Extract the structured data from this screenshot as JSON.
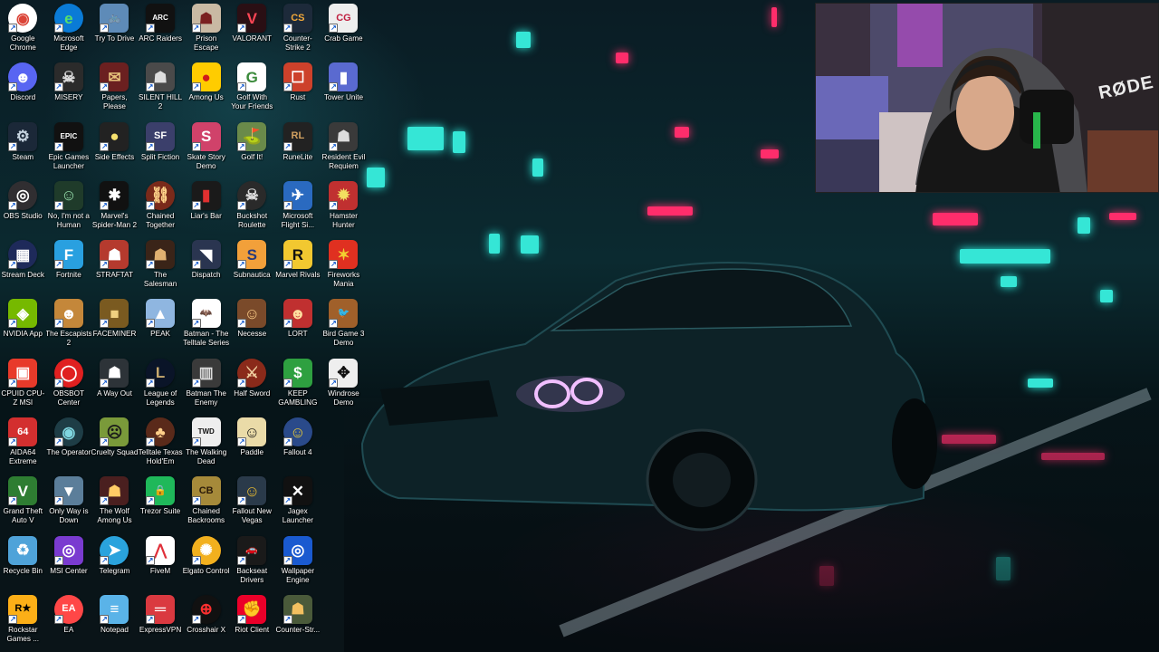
{
  "desktop": {
    "icons": [
      {
        "label": "Google Chrome",
        "icon": "chrome-icon",
        "bg": "#ffffff",
        "fg": "#db4437",
        "glyph": "◉",
        "round": true
      },
      {
        "label": "Discord",
        "icon": "discord-icon",
        "bg": "#5865f2",
        "fg": "#ffffff",
        "glyph": "☻",
        "round": true
      },
      {
        "label": "Steam",
        "icon": "steam-icon",
        "bg": "#1b2838",
        "fg": "#c7d5e0",
        "glyph": "⚙",
        "round": false
      },
      {
        "label": "OBS Studio",
        "icon": "obs-icon",
        "bg": "#302e31",
        "fg": "#ffffff",
        "glyph": "◎",
        "round": true
      },
      {
        "label": "Stream Deck",
        "icon": "stream-deck-icon",
        "bg": "#1e2a5a",
        "fg": "#ffffff",
        "glyph": "▦",
        "round": true
      },
      {
        "label": "NVIDIA App",
        "icon": "nvidia-icon",
        "bg": "#76b900",
        "fg": "#ffffff",
        "glyph": "◈",
        "round": false
      },
      {
        "label": "CPUID CPU-Z MSI",
        "icon": "cpuz-icon",
        "bg": "#e83a2a",
        "fg": "#ffffff",
        "glyph": "▣",
        "round": false
      },
      {
        "label": "AIDA64 Extreme",
        "icon": "aida64-icon",
        "bg": "#d32f2f",
        "fg": "#ffffff",
        "glyph": "64",
        "round": false
      },
      {
        "label": "Grand Theft Auto V",
        "icon": "gta5-icon",
        "bg": "#2e7d32",
        "fg": "#ffffff",
        "glyph": "V",
        "round": false
      },
      {
        "label": "Recycle Bin",
        "icon": "recycle-bin-icon",
        "bg": "#4fa3d9",
        "fg": "#ffffff",
        "glyph": "♻",
        "round": false
      },
      {
        "label": "Rockstar Games ...",
        "icon": "rockstar-icon",
        "bg": "#fcaf17",
        "fg": "#000000",
        "glyph": "R★",
        "round": false
      },
      {
        "label": "Microsoft Edge",
        "icon": "edge-icon",
        "bg": "#0a7bd6",
        "fg": "#58e06a",
        "glyph": "e",
        "round": true
      },
      {
        "label": "MISERY",
        "icon": "misery-icon",
        "bg": "#2b2b2b",
        "fg": "#dddddd",
        "glyph": "☠",
        "round": false
      },
      {
        "label": "Epic Games Launcher",
        "icon": "epic-games-icon",
        "bg": "#111111",
        "fg": "#ffffff",
        "glyph": "EPIC",
        "round": false
      },
      {
        "label": "No, I'm not a Human",
        "icon": "not-human-icon",
        "bg": "#1f3b2a",
        "fg": "#9be3b0",
        "glyph": "☺",
        "round": false
      },
      {
        "label": "Fortnite",
        "icon": "fortnite-icon",
        "bg": "#29a0e0",
        "fg": "#ffffff",
        "glyph": "F",
        "round": false
      },
      {
        "label": "The Escapists 2",
        "icon": "escapists-icon",
        "bg": "#c4873a",
        "fg": "#ffffff",
        "glyph": "☻",
        "round": false
      },
      {
        "label": "OBSBOT Center",
        "icon": "obsbot-icon",
        "bg": "#e02020",
        "fg": "#ffffff",
        "glyph": "◯",
        "round": true
      },
      {
        "label": "The Operator",
        "icon": "operator-icon",
        "bg": "#1e3d46",
        "fg": "#7fd6e0",
        "glyph": "◉",
        "round": true
      },
      {
        "label": "Only Way is Down",
        "icon": "only-way-down-icon",
        "bg": "#5b7e9a",
        "fg": "#ffffff",
        "glyph": "▼",
        "round": false
      },
      {
        "label": "MSI Center",
        "icon": "msi-center-icon",
        "bg": "#7a3bd0",
        "fg": "#ffffff",
        "glyph": "◎",
        "round": false
      },
      {
        "label": "EA",
        "icon": "ea-icon",
        "bg": "#ff4747",
        "fg": "#ffffff",
        "glyph": "EA",
        "round": true
      },
      {
        "label": "Try To Drive",
        "icon": "try-to-drive-icon",
        "bg": "#5e8bb8",
        "fg": "#ffffff",
        "glyph": "🚲",
        "round": false
      },
      {
        "label": "Papers, Please",
        "icon": "papers-please-icon",
        "bg": "#6b2020",
        "fg": "#e6c17a",
        "glyph": "✉",
        "round": false
      },
      {
        "label": "Side Effects",
        "icon": "side-effects-icon",
        "bg": "#222222",
        "fg": "#f5e06e",
        "glyph": "●",
        "round": false
      },
      {
        "label": "Marvel's Spider-Man 2",
        "icon": "spiderman-icon",
        "bg": "#111111",
        "fg": "#ffffff",
        "glyph": "✱",
        "round": false
      },
      {
        "label": "STRAFTAT",
        "icon": "straftat-icon",
        "bg": "#b53a2e",
        "fg": "#ffffff",
        "glyph": "☗",
        "round": false
      },
      {
        "label": "FACEMINER",
        "icon": "faceminer-icon",
        "bg": "#7a5a20",
        "fg": "#f0d080",
        "glyph": "■",
        "round": false
      },
      {
        "label": "A Way Out",
        "icon": "a-way-out-icon",
        "bg": "#2d3338",
        "fg": "#ffffff",
        "glyph": "☗",
        "round": false
      },
      {
        "label": "Cruelty Squad",
        "icon": "cruelty-squad-icon",
        "bg": "#7a9a3a",
        "fg": "#1a1a1a",
        "glyph": "☹",
        "round": false
      },
      {
        "label": "The Wolf Among Us",
        "icon": "wolf-among-us-icon",
        "bg": "#4a1f1f",
        "fg": "#ffcc66",
        "glyph": "☗",
        "round": false
      },
      {
        "label": "Telegram",
        "icon": "telegram-icon",
        "bg": "#2aa3dd",
        "fg": "#ffffff",
        "glyph": "➤",
        "round": true
      },
      {
        "label": "Notepad",
        "icon": "notepad-icon",
        "bg": "#5ab3e8",
        "fg": "#ffffff",
        "glyph": "≡",
        "round": false
      },
      {
        "label": "ARC Raiders",
        "icon": "arc-raiders-icon",
        "bg": "#111111",
        "fg": "#ffffff",
        "glyph": "ARC",
        "round": false
      },
      {
        "label": "SILENT HILL 2",
        "icon": "silent-hill-icon",
        "bg": "#4a4a4a",
        "fg": "#dddddd",
        "glyph": "☗",
        "round": false
      },
      {
        "label": "Split Fiction",
        "icon": "split-fiction-icon",
        "bg": "#3b3f6b",
        "fg": "#ffffff",
        "glyph": "SF",
        "round": false
      },
      {
        "label": "Chained Together",
        "icon": "chained-together-icon",
        "bg": "#7a2a1a",
        "fg": "#ffd38a",
        "glyph": "⛓",
        "round": true
      },
      {
        "label": "The Salesman",
        "icon": "salesman-icon",
        "bg": "#3a2418",
        "fg": "#e0b070",
        "glyph": "☗",
        "round": false
      },
      {
        "label": "PEAK",
        "icon": "peak-icon",
        "bg": "#8fb6e0",
        "fg": "#ffffff",
        "glyph": "▲",
        "round": false
      },
      {
        "label": "League of Legends",
        "icon": "league-icon",
        "bg": "#0a1428",
        "fg": "#c8aa6e",
        "glyph": "L",
        "round": true
      },
      {
        "label": "Telltale Texas Hold'Em",
        "icon": "telltale-poker-icon",
        "bg": "#5a2a1a",
        "fg": "#ffd08a",
        "glyph": "♣",
        "round": true
      },
      {
        "label": "Trezor Suite",
        "icon": "trezor-icon",
        "bg": "#1fb85a",
        "fg": "#ffffff",
        "glyph": "🔒",
        "round": false
      },
      {
        "label": "FiveM",
        "icon": "fivem-icon",
        "bg": "#ffffff",
        "fg": "#e0303a",
        "glyph": "⋀",
        "round": false
      },
      {
        "label": "ExpressVPN",
        "icon": "expressvpn-icon",
        "bg": "#da3940",
        "fg": "#ffffff",
        "glyph": "═",
        "round": false
      },
      {
        "label": "Prison Escape Simulator",
        "icon": "prison-escape-icon",
        "bg": "#c9b9a3",
        "fg": "#7a2020",
        "glyph": "☗",
        "round": false
      },
      {
        "label": "Among Us",
        "icon": "among-us-icon",
        "bg": "#ffcc00",
        "fg": "#d01a1a",
        "glyph": "●",
        "round": false
      },
      {
        "label": "Skate Story Demo",
        "icon": "skate-story-icon",
        "bg": "#d0426a",
        "fg": "#ffffff",
        "glyph": "S",
        "round": false
      },
      {
        "label": "Liar's Bar",
        "icon": "liars-bar-icon",
        "bg": "#1a1a1a",
        "fg": "#e03030",
        "glyph": "▮",
        "round": false
      },
      {
        "label": "Dispatch",
        "icon": "dispatch-icon",
        "bg": "#2a3550",
        "fg": "#ffffff",
        "glyph": "◥",
        "round": false
      },
      {
        "label": "Batman - The Telltale Series",
        "icon": "batman-telltale-icon",
        "bg": "#ffffff",
        "fg": "#111111",
        "glyph": "🦇",
        "round": false
      },
      {
        "label": "Batman The Enemy",
        "icon": "batman-enemy-icon",
        "bg": "#3a3a3a",
        "fg": "#dddddd",
        "glyph": "▥",
        "round": false
      },
      {
        "label": "The Walking Dead",
        "icon": "walking-dead-icon",
        "bg": "#eeeeee",
        "fg": "#111111",
        "glyph": "TWD",
        "round": false
      },
      {
        "label": "Chained Backrooms",
        "icon": "chained-backrooms-icon",
        "bg": "#a68a3a",
        "fg": "#2a1a0a",
        "glyph": "CB",
        "round": false
      },
      {
        "label": "Elgato Control",
        "icon": "elgato-icon",
        "bg": "#f2b01e",
        "fg": "#ffffff",
        "glyph": "✺",
        "round": true
      },
      {
        "label": "Crosshair X",
        "icon": "crosshair-x-icon",
        "bg": "#111111",
        "fg": "#ff3030",
        "glyph": "⊕",
        "round": true
      },
      {
        "label": "VALORANT",
        "icon": "valorant-icon",
        "bg": "#2a0f14",
        "fg": "#ff4655",
        "glyph": "V",
        "round": false
      },
      {
        "label": "Golf With Your Friends",
        "icon": "golf-friends-icon",
        "bg": "#ffffff",
        "fg": "#3a8a3a",
        "glyph": "G",
        "round": false
      },
      {
        "label": "Golf It!",
        "icon": "golf-it-icon",
        "bg": "#6a8a4a",
        "fg": "#ffffff",
        "glyph": "⛳",
        "round": false
      },
      {
        "label": "Buckshot Roulette",
        "icon": "buckshot-icon",
        "bg": "#2a2a2a",
        "fg": "#dddddd",
        "glyph": "☠",
        "round": true
      },
      {
        "label": "Subnautica",
        "icon": "subnautica-icon",
        "bg": "#f2a03a",
        "fg": "#2a3a7a",
        "glyph": "S",
        "round": false
      },
      {
        "label": "Necesse",
        "icon": "necesse-icon",
        "bg": "#7a4a2a",
        "fg": "#ffd08a",
        "glyph": "☺",
        "round": false
      },
      {
        "label": "Half Sword",
        "icon": "half-sword-icon",
        "bg": "#8a2a1a",
        "fg": "#f0d0a0",
        "glyph": "⚔",
        "round": true
      },
      {
        "label": "Paddle",
        "icon": "paddle-icon",
        "bg": "#eadba8",
        "fg": "#111111",
        "glyph": "☺",
        "round": false
      },
      {
        "label": "Fallout New Vegas",
        "icon": "fallout-nv-icon",
        "bg": "#2a3a4a",
        "fg": "#f2c030",
        "glyph": "☺",
        "round": false
      },
      {
        "label": "Backseat Drivers",
        "icon": "backseat-drivers-icon",
        "bg": "#1a1a1a",
        "fg": "#e03030",
        "glyph": "🚗",
        "round": false
      },
      {
        "label": "Riot Client",
        "icon": "riot-client-icon",
        "bg": "#eb0029",
        "fg": "#ffffff",
        "glyph": "✊",
        "round": false
      },
      {
        "label": "Counter-Strike 2",
        "icon": "cs2-icon",
        "bg": "#1d2a3a",
        "fg": "#f2a93a",
        "glyph": "CS",
        "round": false
      },
      {
        "label": "Rust",
        "icon": "rust-icon",
        "bg": "#cd412b",
        "fg": "#ffffff",
        "glyph": "☐",
        "round": false
      },
      {
        "label": "RuneLite",
        "icon": "runelite-icon",
        "bg": "#222222",
        "fg": "#d0a060",
        "glyph": "RL",
        "round": false
      },
      {
        "label": "Microsoft Flight Si...",
        "icon": "flight-sim-icon",
        "bg": "#2a6ac0",
        "fg": "#ffffff",
        "glyph": "✈",
        "round": false
      },
      {
        "label": "Marvel Rivals",
        "icon": "marvel-rivals-icon",
        "bg": "#f2c830",
        "fg": "#111111",
        "glyph": "R",
        "round": false
      },
      {
        "label": "LORT",
        "icon": "lort-icon",
        "bg": "#c03030",
        "fg": "#ffe0a0",
        "glyph": "☻",
        "round": false
      },
      {
        "label": "KEEP GAMBLING",
        "icon": "keep-gambling-icon",
        "bg": "#2ea040",
        "fg": "#ffffff",
        "glyph": "$",
        "round": false
      },
      {
        "label": "Fallout 4",
        "icon": "fallout4-icon",
        "bg": "#2a4a8a",
        "fg": "#f2d030",
        "glyph": "☺",
        "round": true
      },
      {
        "label": "Jagex Launcher",
        "icon": "jagex-icon",
        "bg": "#111111",
        "fg": "#ffffff",
        "glyph": "✕",
        "round": false
      },
      {
        "label": "Wallpaper Engine",
        "icon": "wallpaper-engine-icon",
        "bg": "#1a5ad0",
        "fg": "#ffffff",
        "glyph": "◎",
        "round": false
      },
      {
        "label": "Counter-Str...",
        "icon": "cs-source-icon",
        "bg": "#4a5a3a",
        "fg": "#f2c060",
        "glyph": "☗",
        "round": false
      },
      {
        "label": "Crab Game",
        "icon": "crab-game-icon",
        "bg": "#eeeeee",
        "fg": "#c02040",
        "glyph": "CG",
        "round": false
      },
      {
        "label": "Tower Unite",
        "icon": "tower-unite-icon",
        "bg": "#5a6ad0",
        "fg": "#ffffff",
        "glyph": "▮",
        "round": false
      },
      {
        "label": "Resident Evil Requiem",
        "icon": "re-requiem-icon",
        "bg": "#3a3a3a",
        "fg": "#dddddd",
        "glyph": "☗",
        "round": false
      },
      {
        "label": "Hamster Hunter",
        "icon": "hamster-hunter-icon",
        "bg": "#c03030",
        "fg": "#f2e060",
        "glyph": "✹",
        "round": false
      },
      {
        "label": "Fireworks Mania",
        "icon": "fireworks-mania-icon",
        "bg": "#e03020",
        "fg": "#f2d030",
        "glyph": "✶",
        "round": false
      },
      {
        "label": "Bird Game 3 Demo",
        "icon": "bird-game-icon",
        "bg": "#a0602a",
        "fg": "#ffffff",
        "glyph": "🐦",
        "round": false
      },
      {
        "label": "Windrose Demo",
        "icon": "windrose-icon",
        "bg": "#eeeeee",
        "fg": "#111111",
        "glyph": "✥",
        "round": false
      }
    ]
  },
  "webcam": {
    "mic_brand": "RØDE"
  }
}
